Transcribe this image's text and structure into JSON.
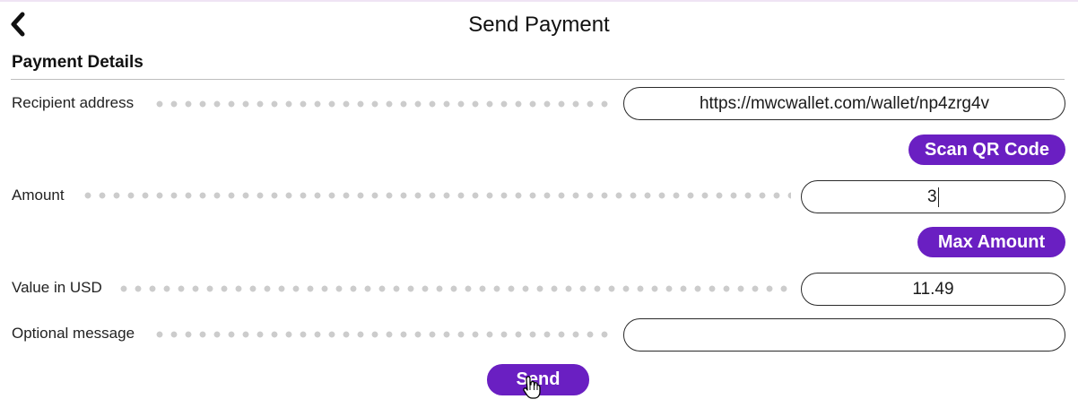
{
  "header": {
    "title": "Send Payment",
    "back_icon": "chevron-left-icon"
  },
  "section": {
    "title": "Payment Details"
  },
  "form": {
    "recipient": {
      "label": "Recipient address",
      "value": "https://mwcwallet.com/wallet/np4zrg4v"
    },
    "scan_button": "Scan QR Code",
    "amount": {
      "label": "Amount",
      "value": "3"
    },
    "max_button": "Max Amount",
    "usd": {
      "label": "Value in USD",
      "value": "11.49"
    },
    "message": {
      "label": "Optional message",
      "value": ""
    }
  },
  "send_button": "Send",
  "colors": {
    "accent": "#6a1fc2",
    "dots": "#cccccc"
  }
}
